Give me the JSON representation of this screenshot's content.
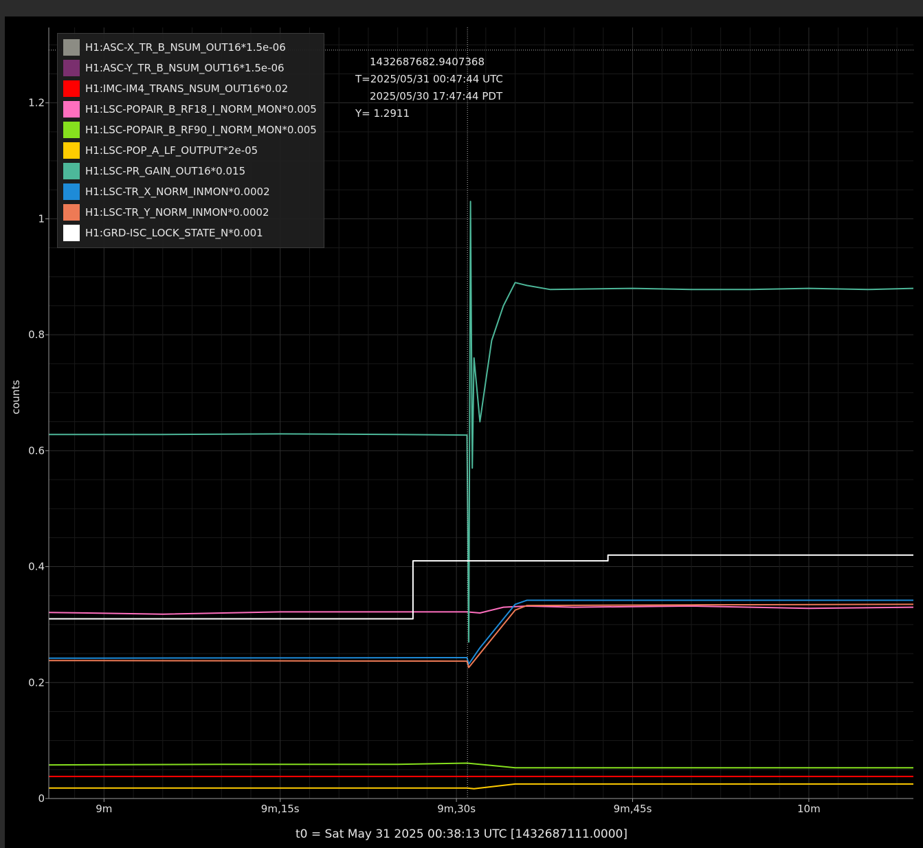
{
  "chart_data": {
    "type": "line",
    "ylabel": "counts",
    "xlabel": "t0 = Sat May 31 2025 00:38:13 UTC [1432687111.0000]",
    "xlim_seconds": [
      535.3,
      608.9
    ],
    "ylim": [
      0,
      1.33
    ],
    "x_ticks": [
      {
        "t": 540,
        "label": "9m"
      },
      {
        "t": 555,
        "label": "9m,15s"
      },
      {
        "t": 570,
        "label": "9m,30s"
      },
      {
        "t": 585,
        "label": "9m,45s"
      },
      {
        "t": 600,
        "label": "10m"
      }
    ],
    "y_ticks": [
      {
        "v": 0,
        "label": "0"
      },
      {
        "v": 0.2,
        "label": "0.2"
      },
      {
        "v": 0.4,
        "label": "0.4"
      },
      {
        "v": 0.6,
        "label": "0.6"
      },
      {
        "v": 0.8,
        "label": "0.8"
      },
      {
        "v": 1.0,
        "label": "1"
      },
      {
        "v": 1.2,
        "label": "1.2"
      }
    ],
    "grid": true,
    "legend_position": "top-left",
    "cursor": {
      "t": 570.94,
      "y": 1.2911,
      "gps": "1432687682.9407368",
      "prefix_t": "T=",
      "utc": "2025/05/31 00:47:44 UTC",
      "pdt": "2025/05/30 17:47:44 PDT",
      "y_text": "Y= 1.2911"
    },
    "series": [
      {
        "name": "H1:ASC-X_TR_B_NSUM_OUT16*1.5e-06",
        "color": "#8c8c84",
        "points": []
      },
      {
        "name": "H1:ASC-Y_TR_B_NSUM_OUT16*1.5e-06",
        "color": "#7a2f6e",
        "points": []
      },
      {
        "name": "H1:IMC-IM4_TRANS_NSUM_OUT16*0.02",
        "color": "#ff0000",
        "points": [
          [
            535.3,
            0.038
          ],
          [
            608.9,
            0.038
          ]
        ]
      },
      {
        "name": "H1:LSC-POPAIR_B_RF18_I_NORM_MON*0.005",
        "color": "#ff6fbf",
        "points": [
          [
            535.3,
            0.321
          ],
          [
            545,
            0.318
          ],
          [
            555,
            0.322
          ],
          [
            565,
            0.322
          ],
          [
            570.9,
            0.322
          ],
          [
            572,
            0.32
          ],
          [
            574,
            0.33
          ],
          [
            576,
            0.332
          ],
          [
            580,
            0.33
          ],
          [
            590,
            0.332
          ],
          [
            600,
            0.328
          ],
          [
            608.9,
            0.33
          ]
        ]
      },
      {
        "name": "H1:LSC-POPAIR_B_RF90_I_NORM_MON*0.005",
        "color": "#86e01e",
        "points": [
          [
            535.3,
            0.058
          ],
          [
            550,
            0.059
          ],
          [
            565,
            0.059
          ],
          [
            570.9,
            0.061
          ],
          [
            573,
            0.057
          ],
          [
            575,
            0.053
          ],
          [
            590,
            0.053
          ],
          [
            608.9,
            0.053
          ]
        ]
      },
      {
        "name": "H1:LSC-POP_A_LF_OUTPUT*2e-05",
        "color": "#ffcc00",
        "points": [
          [
            535.3,
            0.018
          ],
          [
            570.9,
            0.018
          ],
          [
            571.5,
            0.017
          ],
          [
            575,
            0.025
          ],
          [
            608.9,
            0.025
          ]
        ]
      },
      {
        "name": "H1:LSC-PR_GAIN_OUT16*0.015",
        "color": "#4db89a",
        "points": [
          [
            535.3,
            0.628
          ],
          [
            545,
            0.628
          ],
          [
            555,
            0.629
          ],
          [
            565,
            0.628
          ],
          [
            570.9,
            0.627
          ],
          [
            571.05,
            0.27
          ],
          [
            571.2,
            1.03
          ],
          [
            571.35,
            0.57
          ],
          [
            571.5,
            0.76
          ],
          [
            572,
            0.65
          ],
          [
            572.5,
            0.72
          ],
          [
            573,
            0.79
          ],
          [
            574,
            0.85
          ],
          [
            575,
            0.89
          ],
          [
            576,
            0.885
          ],
          [
            578,
            0.878
          ],
          [
            585,
            0.88
          ],
          [
            590,
            0.878
          ],
          [
            595,
            0.878
          ],
          [
            600,
            0.88
          ],
          [
            605,
            0.878
          ],
          [
            608.9,
            0.88
          ]
        ]
      },
      {
        "name": "H1:LSC-TR_X_NORM_INMON*0.0002",
        "color": "#1e8bd8",
        "points": [
          [
            535.3,
            0.242
          ],
          [
            570.9,
            0.243
          ],
          [
            571.05,
            0.232
          ],
          [
            572,
            0.26
          ],
          [
            574,
            0.31
          ],
          [
            575,
            0.335
          ],
          [
            576,
            0.342
          ],
          [
            590,
            0.342
          ],
          [
            608.9,
            0.342
          ]
        ]
      },
      {
        "name": "H1:LSC-TR_Y_NORM_INMON*0.0002",
        "color": "#ee7a55",
        "points": [
          [
            535.3,
            0.238
          ],
          [
            570.9,
            0.237
          ],
          [
            571.05,
            0.226
          ],
          [
            572,
            0.25
          ],
          [
            574,
            0.3
          ],
          [
            575,
            0.325
          ],
          [
            576,
            0.333
          ],
          [
            590,
            0.334
          ],
          [
            608.9,
            0.335
          ]
        ]
      },
      {
        "name": "H1:GRD-ISC_LOCK_STATE_N*0.001",
        "color": "#ffffff",
        "step": true,
        "points": [
          [
            535.3,
            0.31
          ],
          [
            566.3,
            0.31
          ],
          [
            566.3,
            0.41
          ],
          [
            582.9,
            0.41
          ],
          [
            582.9,
            0.42
          ],
          [
            608.9,
            0.42
          ]
        ]
      }
    ]
  }
}
